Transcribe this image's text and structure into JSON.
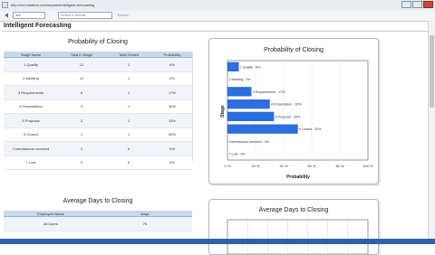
{
  "browser": {
    "address": "http://crm.eastern.com/reports/intelligent-forecasting"
  },
  "toolbar": {
    "page_label": "1/2",
    "format_placeholder": "Select a format",
    "export_label": "Export"
  },
  "page": {
    "title": "Intelligent Forecasting"
  },
  "prob_section": {
    "title": "Probability of Closing",
    "columns": [
      "Stage Name",
      "Total in Stage",
      "Total Closed",
      "Probability"
    ],
    "rows": [
      [
        "1 Qualify",
        "12",
        "1",
        "8%"
      ],
      [
        "2 Meeting",
        "12",
        "1",
        "0%"
      ],
      [
        "3 Requirements",
        "6",
        "1",
        "17%"
      ],
      [
        "4 Presentation",
        "3",
        "1",
        "30%"
      ],
      [
        "5 Proposal",
        "2",
        "1",
        "33%"
      ],
      [
        "6 Closed",
        "1",
        "1",
        "50%"
      ],
      [
        "Commissions received",
        "1",
        "0",
        "0%"
      ],
      [
        "7 Lost",
        "0",
        "0",
        "0%"
      ]
    ]
  },
  "avg_section": {
    "title": "Average Days to Closing",
    "columns": [
      "Employee Name",
      "Days"
    ],
    "rows": [
      [
        "All Users",
        "75"
      ]
    ]
  },
  "chart_data": [
    {
      "type": "bar",
      "title": "Probability of Closing",
      "xlabel": "Probability",
      "ylabel": "Stage",
      "categories": [
        "1 Qualify",
        "2 Meeting",
        "3 Requirements",
        "4 Presentation",
        "5 Proposal",
        "6 Closed",
        "Commissions received",
        "7 Lost"
      ],
      "value_labels": [
        "1 Qualify - 8%",
        "2 Meeting - 0%",
        "3 Requirements - 17%",
        "4 Presentation - 30%",
        "5 Proposal - 33%",
        "6 Closed - 50%",
        "Commissions received - 0%",
        "7 Lost - 0%"
      ],
      "values": [
        8,
        0,
        17,
        30,
        33,
        50,
        0,
        0
      ],
      "xlim": [
        0,
        100
      ],
      "xticks": [
        "0 %",
        "20 %",
        "40 %",
        "60 %",
        "80 %",
        "100 %"
      ],
      "bar_color": "#2b6fe0",
      "grid": true
    },
    {
      "type": "bar",
      "title": "Average Days to Closing",
      "grid": true
    }
  ]
}
